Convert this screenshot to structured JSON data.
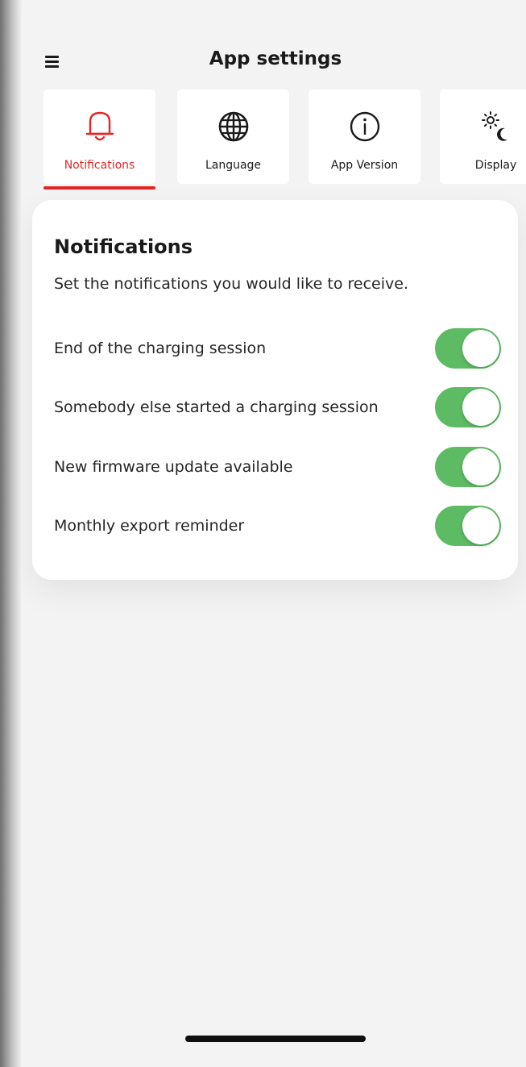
{
  "header": {
    "title": "App settings"
  },
  "tabs": [
    {
      "label": "Notifications",
      "icon": "bell-icon",
      "active": true
    },
    {
      "label": "Language",
      "icon": "globe-icon",
      "active": false
    },
    {
      "label": "App Version",
      "icon": "info-icon",
      "active": false
    },
    {
      "label": "Display",
      "icon": "sun-moon-icon",
      "active": false
    }
  ],
  "notifications": {
    "title": "Notifications",
    "description": "Set the notifications you would like to receive.",
    "items": [
      {
        "label": "End of the charging session",
        "enabled": true
      },
      {
        "label": "Somebody else started a charging session",
        "enabled": true
      },
      {
        "label": "New firmware update available",
        "enabled": true
      },
      {
        "label": "Monthly export reminder",
        "enabled": true
      }
    ]
  },
  "colors": {
    "accent": "#e22626",
    "toggle_on": "#5dbb63",
    "background": "#f3f3f3"
  }
}
